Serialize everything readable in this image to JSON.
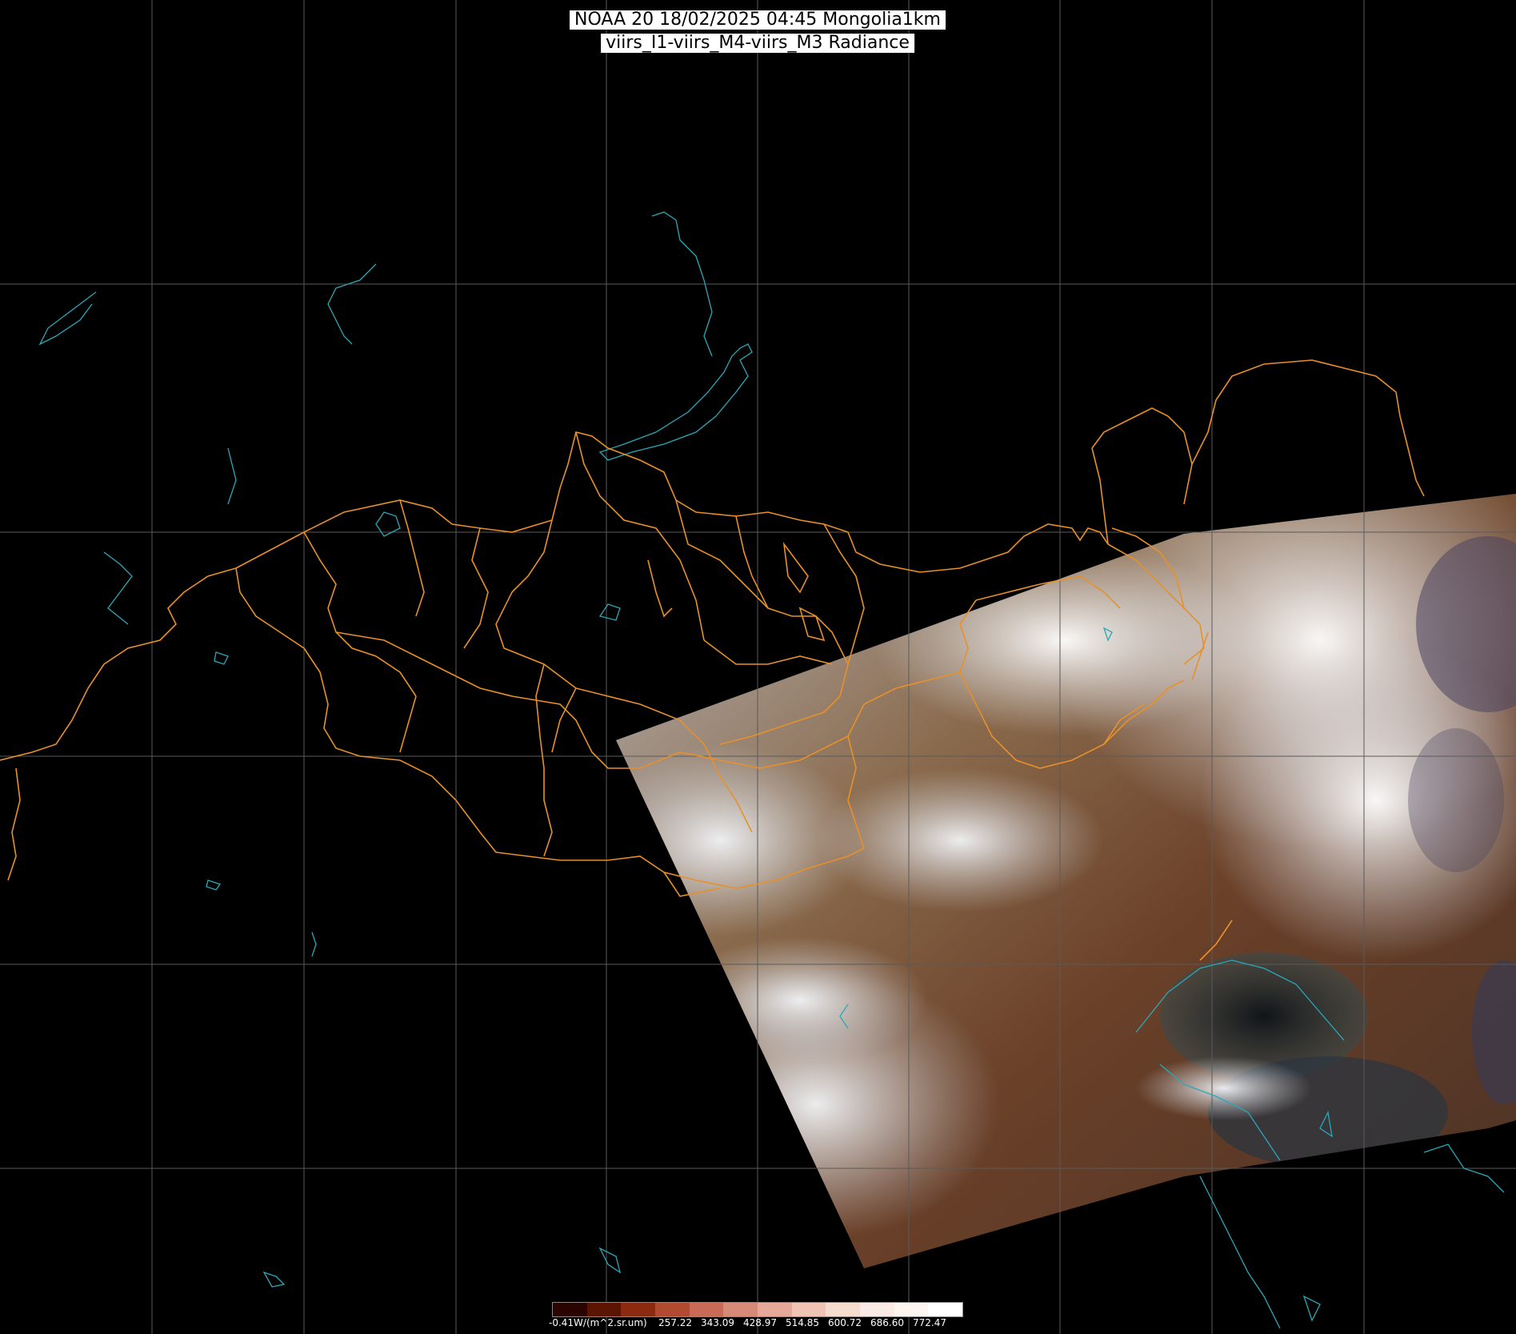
{
  "title": {
    "line1": "NOAA 20 18/02/2025 04:45 Mongolia1km",
    "line2": "viirs_I1-viirs_M4-viirs_M3 Radiance"
  },
  "colors": {
    "background": "#000000",
    "grid": "#5a5a5a",
    "border": "#e8902a",
    "water": "#2aa8b8",
    "snow": "#e6eaf0",
    "land": "#7a5236"
  },
  "colorbar": {
    "swatches": [
      "#2a0500",
      "#5a1400",
      "#8a2a10",
      "#b04a30",
      "#c86a55",
      "#d88a78",
      "#e6a898",
      "#f0c4b4",
      "#f6dccf",
      "#faece4",
      "#fdf6f0",
      "#ffffff"
    ],
    "labels": [
      "-0.41W/(m^2.sr.um)",
      "257.22",
      "343.09",
      "428.97",
      "514.85",
      "600.72",
      "686.60",
      "772.47"
    ]
  }
}
